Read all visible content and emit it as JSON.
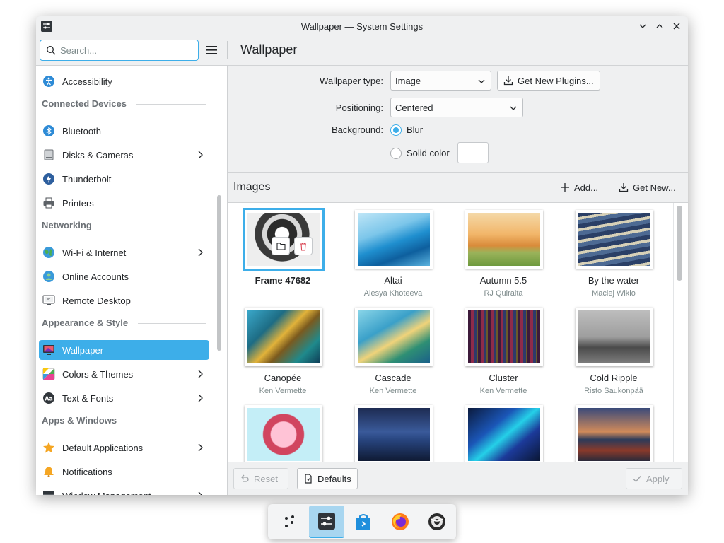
{
  "window": {
    "title": "Wallpaper — System Settings"
  },
  "search": {
    "placeholder": "Search..."
  },
  "page_title": "Wallpaper",
  "sidebar": {
    "items": [
      {
        "type": "item",
        "label": "Accessibility",
        "icon": "accessibility-icon"
      },
      {
        "type": "header",
        "label": "Connected Devices"
      },
      {
        "type": "item",
        "label": "Bluetooth",
        "icon": "bluetooth-icon"
      },
      {
        "type": "item",
        "label": "Disks & Cameras",
        "icon": "disk-icon",
        "chevron": true
      },
      {
        "type": "item",
        "label": "Thunderbolt",
        "icon": "thunderbolt-icon"
      },
      {
        "type": "item",
        "label": "Printers",
        "icon": "printer-icon"
      },
      {
        "type": "header",
        "label": "Networking"
      },
      {
        "type": "item",
        "label": "Wi-Fi & Internet",
        "icon": "globe-icon",
        "chevron": true
      },
      {
        "type": "item",
        "label": "Online Accounts",
        "icon": "online-accounts-icon"
      },
      {
        "type": "item",
        "label": "Remote Desktop",
        "icon": "remote-desktop-icon"
      },
      {
        "type": "header",
        "label": "Appearance & Style"
      },
      {
        "type": "item",
        "label": "Wallpaper",
        "icon": "wallpaper-icon",
        "selected": true
      },
      {
        "type": "item",
        "label": "Colors & Themes",
        "icon": "colors-icon",
        "chevron": true
      },
      {
        "type": "item",
        "label": "Text & Fonts",
        "icon": "fonts-icon",
        "chevron": true
      },
      {
        "type": "header",
        "label": "Apps & Windows"
      },
      {
        "type": "item",
        "label": "Default Applications",
        "icon": "star-icon",
        "chevron": true
      },
      {
        "type": "item",
        "label": "Notifications",
        "icon": "bell-icon"
      },
      {
        "type": "item",
        "label": "Window Management",
        "icon": "window-icon",
        "chevron": true
      }
    ]
  },
  "form": {
    "wallpaper_type_label": "Wallpaper type:",
    "wallpaper_type_value": "Image",
    "get_new_plugins": "Get New Plugins...",
    "positioning_label": "Positioning:",
    "positioning_value": "Centered",
    "background_label": "Background:",
    "blur_label": "Blur",
    "solid_color_label": "Solid color",
    "background_selected": "Blur",
    "solid_color_value": "#ffffff"
  },
  "images": {
    "title": "Images",
    "add_label": "Add...",
    "get_new_label": "Get New...",
    "items": [
      {
        "name": "Frame 47682",
        "author": "",
        "selected": true
      },
      {
        "name": "Altai",
        "author": "Alesya Khoteeva"
      },
      {
        "name": "Autumn 5.5",
        "author": "RJ Quiralta"
      },
      {
        "name": "By the water",
        "author": "Maciej Wiklo"
      },
      {
        "name": "Canopée",
        "author": "Ken Vermette"
      },
      {
        "name": "Cascade",
        "author": "Ken Vermette"
      },
      {
        "name": "Cluster",
        "author": "Ken Vermette"
      },
      {
        "name": "Cold Ripple",
        "author": "Risto Saukonpää"
      },
      {
        "name": "",
        "author": ""
      },
      {
        "name": "",
        "author": ""
      },
      {
        "name": "",
        "author": ""
      },
      {
        "name": "",
        "author": ""
      }
    ]
  },
  "footer": {
    "reset_label": "Reset",
    "defaults_label": "Defaults",
    "apply_label": "Apply"
  },
  "dock": {
    "items": [
      {
        "icon": "app-launcher-icon"
      },
      {
        "icon": "system-settings-icon",
        "active": true
      },
      {
        "icon": "discover-store-icon"
      },
      {
        "icon": "firefox-icon"
      },
      {
        "icon": "wallpaper-app-icon"
      }
    ]
  },
  "colors": {
    "accent": "#3daee9",
    "window_bg": "#eff0f1",
    "text": "#232629",
    "muted_text": "#7f8c8d"
  }
}
